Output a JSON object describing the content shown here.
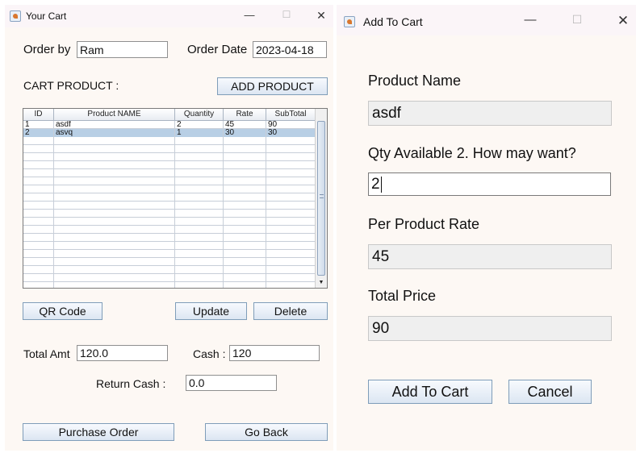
{
  "cart_window": {
    "title": "Your Cart",
    "order_by_label": "Order by",
    "order_by_value": "Ram",
    "order_date_label": "Order Date",
    "order_date_value": "2023-04-18",
    "cart_product_label": "CART PRODUCT :",
    "add_product_button": "ADD PRODUCT",
    "table": {
      "columns": [
        "ID",
        "Product NAME",
        "Quantity",
        "Rate",
        "SubTotal"
      ],
      "rows": [
        [
          "1",
          "asdf",
          "2",
          "45",
          "90"
        ],
        [
          "2",
          "asvq",
          "1",
          "30",
          "30"
        ]
      ],
      "selected_row": 1
    },
    "qr_button": "QR Code",
    "update_button": "Update",
    "delete_button": "Delete",
    "total_amt_label": "Total Amt",
    "total_amt_value": "120.0",
    "cash_label": "Cash :",
    "cash_value": "120",
    "return_cash_label": "Return Cash :",
    "return_cash_value": "0.0",
    "purchase_button": "Purchase Order",
    "go_back_button": "Go Back"
  },
  "add_window": {
    "title": "Add To Cart",
    "product_name_label": "Product Name",
    "product_name_value": "asdf",
    "qty_label": "Qty Available 2. How may want?",
    "qty_value": "2",
    "rate_label": "Per Product Rate",
    "rate_value": "45",
    "total_label": "Total Price",
    "total_value": "90",
    "add_button": "Add To Cart",
    "cancel_button": "Cancel"
  },
  "controls": {
    "minimize": "—",
    "maximize": "☐",
    "close": "✕"
  },
  "colors": {
    "window_bg": "#fdf8f4",
    "selection": "#b8cfe5",
    "button_border": "#7f9db9"
  }
}
